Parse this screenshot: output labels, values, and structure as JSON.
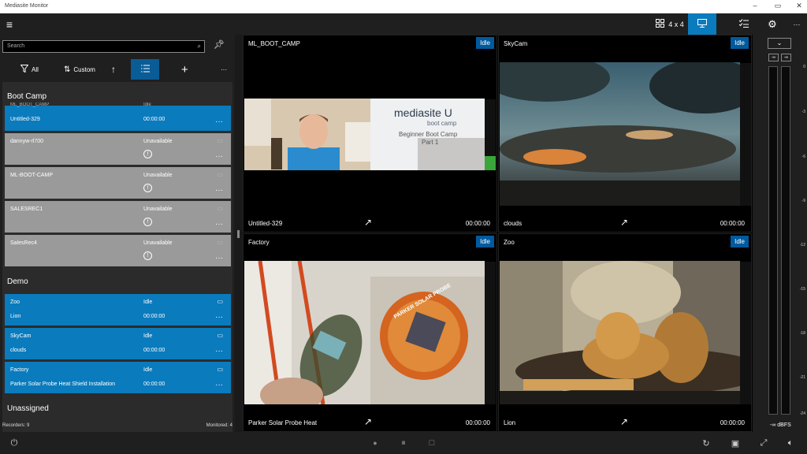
{
  "window": {
    "title": "Mediasite Monitor",
    "minimize": "–",
    "restore": "▭",
    "close": "✕"
  },
  "topbar": {
    "hamburger": "≡",
    "grid_label": "4 x 4",
    "more": "···"
  },
  "sidebar": {
    "search_placeholder": "Search",
    "filter_label": "All",
    "sort_label": "Custom",
    "more": "···",
    "groups": [
      {
        "name": "Boot Camp"
      },
      {
        "name": "Demo"
      },
      {
        "name": "Unassigned"
      }
    ],
    "cards": [
      {
        "name": "Untitled-329",
        "duration": "00:00:00",
        "partial": "ML_BOOT_CAMP",
        "partial_status": "Idle"
      },
      {
        "name": "dannyw-rl700",
        "status": "Unavailable"
      },
      {
        "name": "ML-BOOT-CAMP",
        "status": "Unavailable"
      },
      {
        "name": "SALESREC1",
        "status": "Unavailable"
      },
      {
        "name": "SalesRec4",
        "status": "Unavailable"
      },
      {
        "name": "Zoo",
        "status": "Idle",
        "presentation": "Lion",
        "duration": "00:00:00"
      },
      {
        "name": "SkyCam",
        "status": "Idle",
        "presentation": "clouds",
        "duration": "00:00:00"
      },
      {
        "name": "Factory",
        "status": "Idle",
        "presentation": "Parker Solar Probe Heat Shield Installation",
        "duration": "00:00:00"
      }
    ],
    "recorders": "Recorders: 9",
    "monitored": "Monitored: 4"
  },
  "tiles": [
    {
      "name": "ML_BOOT_CAMP",
      "status": "Idle",
      "presentation": "Untitled-329",
      "time": "00:00:00",
      "slide_brand": "mediasite U",
      "slide_sub": "boot camp",
      "slide_title": "Beginner Boot Camp",
      "slide_part": "Part 1"
    },
    {
      "name": "SkyCam",
      "status": "Idle",
      "presentation": "clouds",
      "time": "00:00:00"
    },
    {
      "name": "Factory",
      "status": "Idle",
      "presentation": "Parker Solar Probe Heat",
      "time": "00:00:00",
      "patch_text": "PARKER SOLAR PROBE"
    },
    {
      "name": "Zoo",
      "status": "Idle",
      "presentation": "Lion",
      "time": "00:00:00"
    }
  ],
  "meter": {
    "left_peak": "-∞",
    "right_peak": "-∞",
    "ticks": [
      "0",
      "-3",
      "-6",
      "-9",
      "-12",
      "-15",
      "-18",
      "-21",
      "-24"
    ],
    "level_readout": "-∞ dBFS"
  },
  "colors": {
    "accent": "#0a7bbd",
    "idle_badge": "#005a9e",
    "unavailable": "#9a9a9a"
  }
}
